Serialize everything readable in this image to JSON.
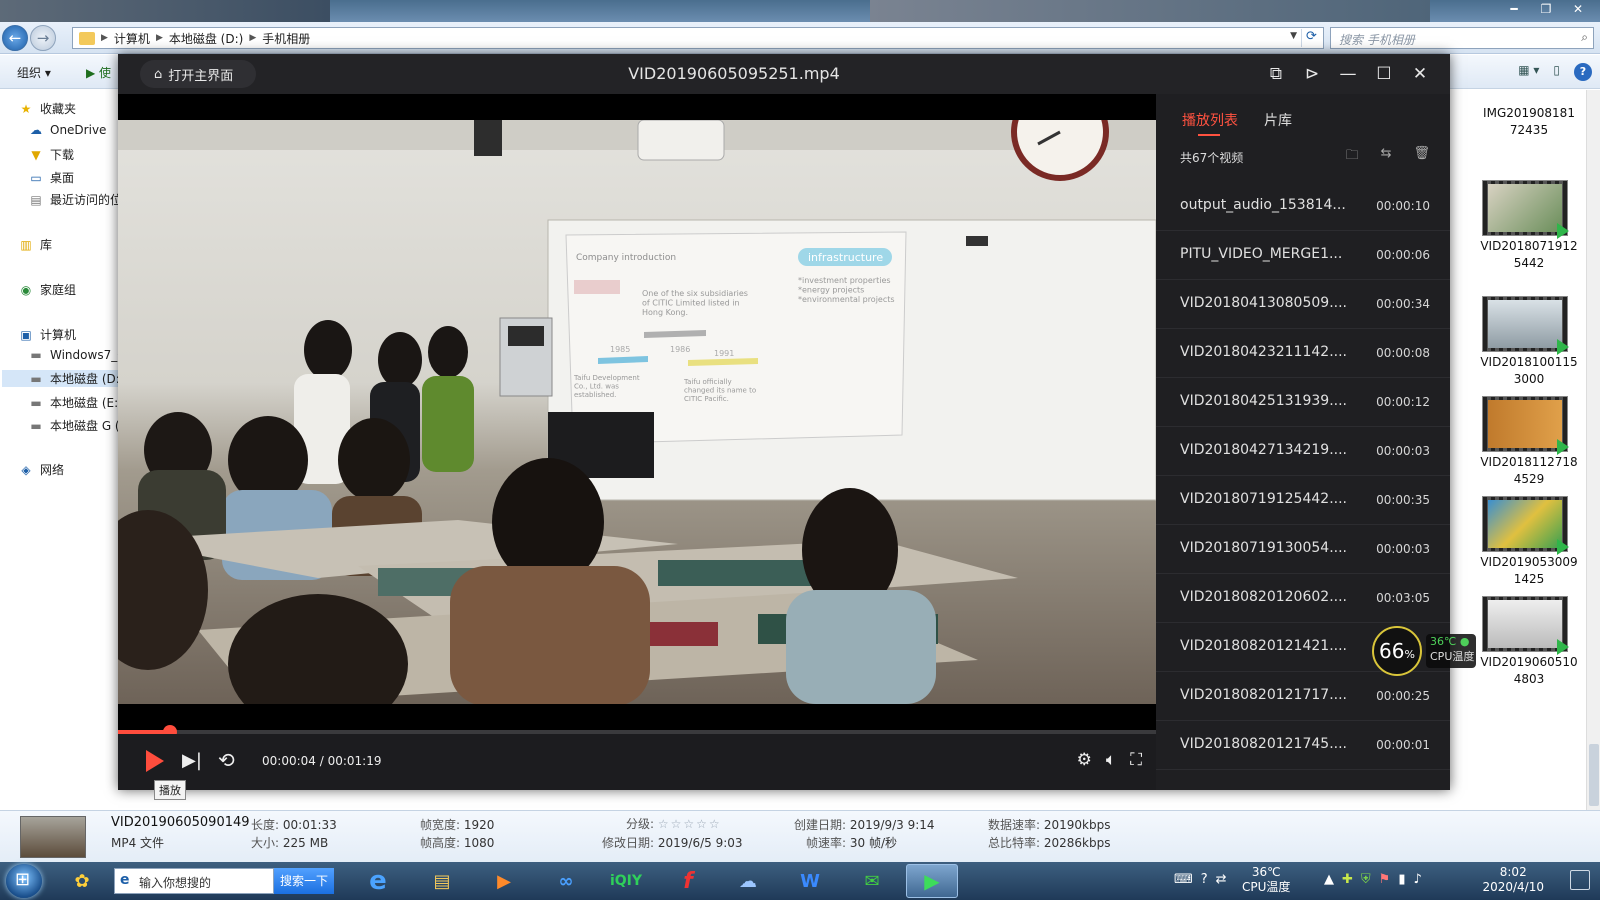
{
  "explorer": {
    "breadcrumb": [
      "计算机",
      "本地磁盘 (D:)",
      "手机相册"
    ],
    "search_placeholder": "搜索 手机相册",
    "toolbar": {
      "organize": "组织 ▾",
      "use": "使"
    },
    "nav": {
      "favorites": "收藏夹",
      "onedrive": "OneDrive",
      "downloads": "下载",
      "desktop": "桌面",
      "recent": "最近访问的位",
      "libraries": "库",
      "homegroup": "家庭组",
      "computer": "计算机",
      "drive_c": "Windows7_C",
      "drive_d": "本地磁盘 (D:",
      "drive_e": "本地磁盘 (E:)",
      "drive_g": "本地磁盘 G (",
      "network": "网络"
    },
    "thumbnails": [
      {
        "line1": "IMG201908181",
        "line2": "72435"
      },
      {
        "line1": "VID2018071912",
        "line2": "5442"
      },
      {
        "line1": "VID2018100115",
        "line2": "3000"
      },
      {
        "line1": "VID2018112718",
        "line2": "4529"
      },
      {
        "line1": "VID2019053009",
        "line2": "1425"
      },
      {
        "line1": "VID2019060510",
        "line2": "4803"
      }
    ],
    "details": {
      "filename": "VID20190605090149",
      "filetype": "MP4 文件",
      "length_k": "长度:",
      "length_v": "00:01:33",
      "size_k": "大小:",
      "size_v": "225 MB",
      "fwidth_k": "帧宽度:",
      "fwidth_v": "1920",
      "fheight_k": "帧高度:",
      "fheight_v": "1080",
      "rating_k": "分级:",
      "rating_stars": "☆☆☆☆☆",
      "modified_k": "修改日期:",
      "modified_v": "2019/6/5 9:03",
      "created_k": "创建日期:",
      "created_v": "2019/9/3 9:14",
      "framerate_k": "帧速率:",
      "framerate_v": "30 帧/秒",
      "datarate_k": "数据速率:",
      "datarate_v": "20190kbps",
      "bitrate_k": "总比特率:",
      "bitrate_v": "20286kbps"
    }
  },
  "player": {
    "home_label": "打开主界面",
    "title": "VID20190605095251.mp4",
    "time": "00:00:04 / 00:01:19",
    "progress_fraction": 0.05,
    "play_tooltip": "播放",
    "tabs": {
      "playlist": "播放列表",
      "library": "片库"
    },
    "count": "共67个视频",
    "playlist": [
      {
        "name": "output_audio_153814...",
        "dur": "00:00:10"
      },
      {
        "name": "PITU_VIDEO_MERGE1...",
        "dur": "00:00:06"
      },
      {
        "name": "VID20180413080509....",
        "dur": "00:00:34"
      },
      {
        "name": "VID20180423211142....",
        "dur": "00:00:08"
      },
      {
        "name": "VID20180425131939....",
        "dur": "00:00:12"
      },
      {
        "name": "VID20180427134219....",
        "dur": "00:00:03"
      },
      {
        "name": "VID20180719125442....",
        "dur": "00:00:35"
      },
      {
        "name": "VID20180719130054....",
        "dur": "00:00:03"
      },
      {
        "name": "VID20180820120602....",
        "dur": "00:03:05"
      },
      {
        "name": "VID20180820121421....",
        "dur": ""
      },
      {
        "name": "VID20180820121717....",
        "dur": "00:00:25"
      },
      {
        "name": "VID20180820121745....",
        "dur": "00:00:01"
      }
    ]
  },
  "slide": {
    "header": "Company introduction",
    "tag": "infrastructure",
    "bullets": "*investment properties\n*energy projects\n*environmental projects",
    "desc1": "One of the six subsidiaries\nof CITIC Limited listed in\nHong Kong.",
    "year1": "1985",
    "year2": "1986",
    "year3": "1991",
    "desc2": "Taifu Development\nCo., Ltd. was\nestablished.",
    "desc3": "Taifu officially\nchanged its name to\nCITIC Pacific."
  },
  "cpu_widget": {
    "percent": "66",
    "unit": "%",
    "temp": "36℃",
    "label": "CPU温度"
  },
  "taskbar": {
    "search_placeholder": "输入你想搜的",
    "search_button": "搜索一下",
    "cpu_temp": "36℃",
    "cpu_label": "CPU温度",
    "time": "8:02",
    "date": "2020/4/10"
  }
}
